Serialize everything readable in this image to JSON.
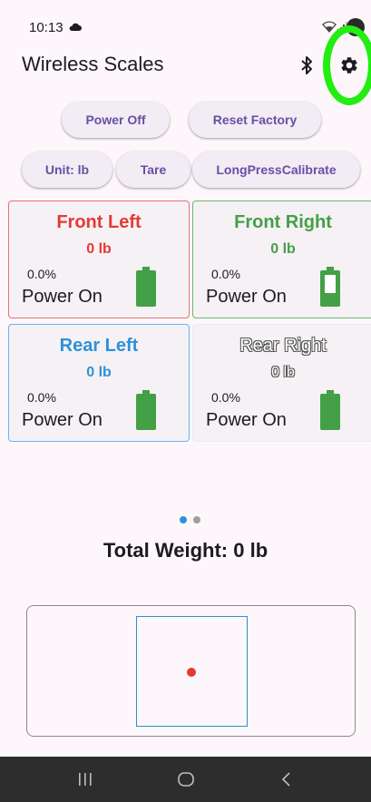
{
  "status_bar": {
    "time": "10:13"
  },
  "app_bar": {
    "title": "Wireless Scales"
  },
  "buttons": {
    "power_off": "Power Off",
    "reset_factory": "Reset Factory",
    "unit": "Unit: lb",
    "tare": "Tare",
    "long_press_calibrate": "LongPressCalibrate"
  },
  "scales": [
    {
      "name": "Front Left",
      "weight": "0 lb",
      "percent": "0.0%",
      "power": "Power On",
      "color": "#e53935",
      "battery_level": 1.0
    },
    {
      "name": "Front Right",
      "weight": "0 lb",
      "percent": "0.0%",
      "power": "Power On",
      "color": "#43a047",
      "battery_level": 0.2
    },
    {
      "name": "Rear Left",
      "weight": "0 lb",
      "percent": "0.0%",
      "power": "Power On",
      "color": "#2e91d8",
      "battery_level": 1.0
    },
    {
      "name": "Rear Right",
      "weight": "0 lb",
      "percent": "0.0%",
      "power": "Power On",
      "color": "#ffffff",
      "battery_level": 1.0
    }
  ],
  "pager": {
    "count": 2,
    "active": 0,
    "active_color": "#2e91d8",
    "inactive_color": "#9e9e9e"
  },
  "total": {
    "label": "Total Weight: 0 lb"
  },
  "balance": {
    "point_x": 0.5,
    "point_y": 0.5,
    "point_color": "#e53935"
  },
  "icons": {
    "cloud": "cloud-icon",
    "wifi": "wifi-icon",
    "signal": "signal-icon",
    "bluetooth": "bluetooth-icon",
    "settings": "gear-icon",
    "nav_recents": "recents-icon",
    "nav_home": "home-icon",
    "nav_back": "back-icon"
  },
  "colors": {
    "accent": "#6750a4",
    "battery": "#43a047",
    "highlight": "#22ee11"
  }
}
